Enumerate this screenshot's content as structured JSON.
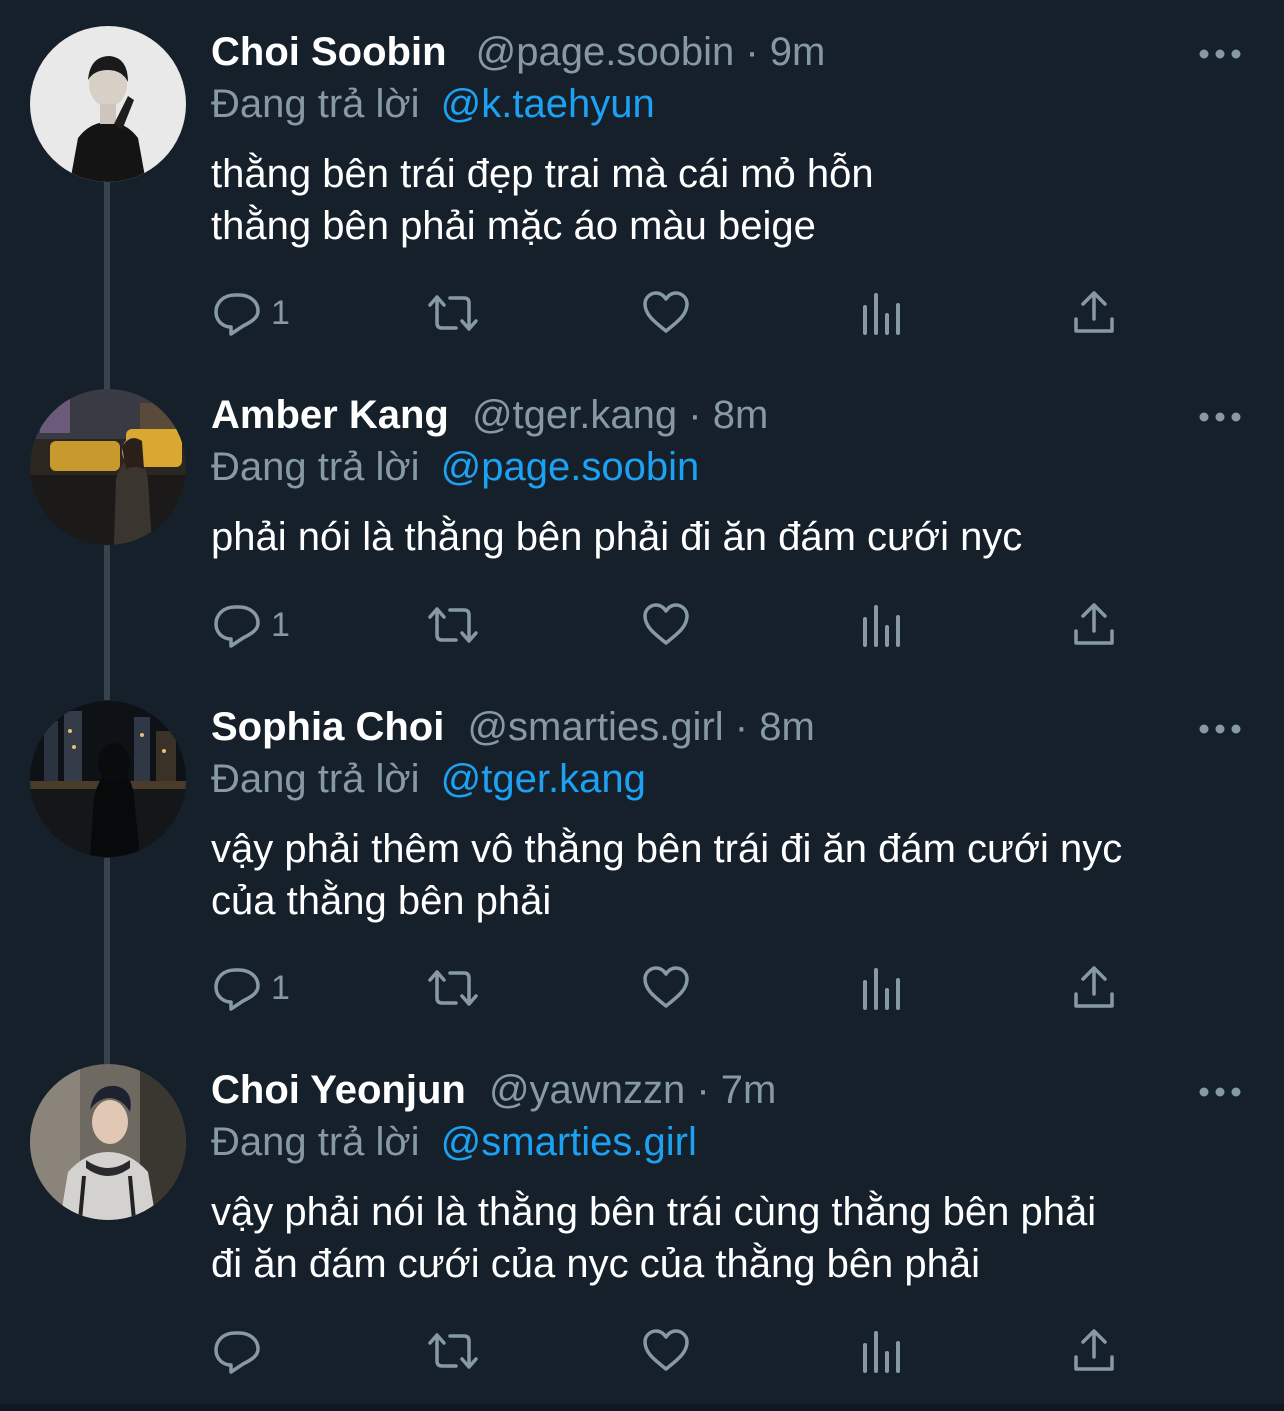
{
  "thread": [
    {
      "name": "Choi Soobin",
      "handle": "@page.soobin",
      "separator": "·",
      "time": "9m",
      "reply_label": "Đang trả lời",
      "reply_to": "@k.taehyun",
      "lines": [
        "thằng bên trái đẹp trai mà cái mỏ hỗn",
        "thằng bên phải mặc áo màu beige"
      ],
      "reply_count": "1"
    },
    {
      "name": "Amber Kang",
      "handle": "@tger.kang",
      "separator": "·",
      "time": "8m",
      "reply_label": "Đang trả lời",
      "reply_to": "@page.soobin",
      "lines": [
        "phải nói là thằng bên phải đi ăn đám cưới nyc"
      ],
      "reply_count": "1"
    },
    {
      "name": "Sophia Choi",
      "handle": "@smarties.girl",
      "separator": "·",
      "time": "8m",
      "reply_label": "Đang trả lời",
      "reply_to": "@tger.kang",
      "lines": [
        "vậy phải thêm vô thằng bên trái đi ăn đám cưới nyc",
        "của thằng bên phải"
      ],
      "reply_count": "1"
    },
    {
      "name": "Choi Yeonjun",
      "handle": "@yawnzzn",
      "separator": "·",
      "time": "7m",
      "reply_label": "Đang trả lời",
      "reply_to": "@smarties.girl",
      "lines": [
        "vậy phải nói là thằng bên trái cùng thằng bên phải",
        "đi ăn đám cưới của nyc của thằng bên phải"
      ],
      "reply_count": ""
    }
  ],
  "icons": {
    "reply": "reply-icon",
    "retweet": "retweet-icon",
    "like": "heart-icon",
    "stats": "analytics-icon",
    "share": "share-icon",
    "more": "more-icon"
  },
  "colors": {
    "background": "#15202b",
    "text": "#ffffff",
    "muted": "#8899a6",
    "link": "#1da1f2",
    "thread_line": "#38444d"
  }
}
